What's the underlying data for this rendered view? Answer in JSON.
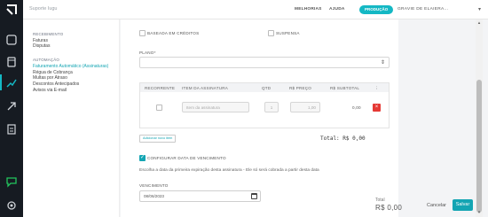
{
  "topbar": {
    "support": "Suporte Iugu",
    "nav_improvements": "MELHORIAS",
    "nav_help": "AJUDA",
    "env_badge": "PRODUÇÃO",
    "account_name": "GRAVIE DE ELAIERA..."
  },
  "menu": {
    "sections": [
      {
        "title": "RECEBIMENTO",
        "items": [
          "Faturas",
          "Disputas"
        ]
      },
      {
        "title": "AUTOMAÇÃO",
        "items": [
          "Faturamento Automático (Assinaturas)",
          "Régua de Cobrança",
          "Multas por Atraso",
          "Descontos Antecipados",
          "Avisos via E-mail"
        ]
      }
    ],
    "active_item": "Faturamento Automático (Assinaturas)"
  },
  "form": {
    "option_credits": "BASEADA EM CRÉDITOS",
    "option_suspended": "SUSPENSA",
    "plan_label": "PLANO*",
    "plan_value": "",
    "table": {
      "headers": [
        "RECORRENTE",
        "ITEM DA ASSINATURA",
        "QTD",
        "R$ PREÇO",
        "R$ SUBTOTAL"
      ],
      "row": {
        "item_placeholder": "Item da assinatura",
        "qty": "1",
        "price": "1,00",
        "subtotal": "0,00"
      },
      "menu_icon": "⋮",
      "delete_icon": "×"
    },
    "add_item": "Adicionar novo item",
    "total_line": "Total: R$ 0,00",
    "config_due_label": "CONFIGURAR DATA DE VENCIMENTO",
    "config_due_checked": true,
    "due_description": "Escolha a data da primeira expiração desta assinatura - Ele só será cobrada a partir desta data",
    "due_label": "VENCIMENTO",
    "due_value": "08/06/2023"
  },
  "footer": {
    "total_label": "Total",
    "total_value": "R$ 0,00",
    "cancel": "Cancelar",
    "save": "Salvar"
  },
  "colors": {
    "accent": "#14a5b3",
    "rail": "#161b22",
    "danger": "#e53935"
  }
}
